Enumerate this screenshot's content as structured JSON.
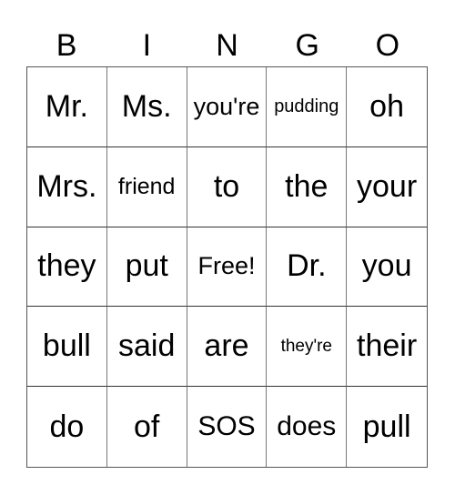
{
  "header": [
    "B",
    "I",
    "N",
    "G",
    "O"
  ],
  "cells": [
    [
      "Mr.",
      "Ms.",
      "you're",
      "pudding",
      "oh"
    ],
    [
      "Mrs.",
      "friend",
      "to",
      "the",
      "your"
    ],
    [
      "they",
      "put",
      "Free!",
      "Dr.",
      "you"
    ],
    [
      "bull",
      "said",
      "are",
      "they're",
      "their"
    ],
    [
      "do",
      "of",
      "SOS",
      "does",
      "pull"
    ]
  ]
}
